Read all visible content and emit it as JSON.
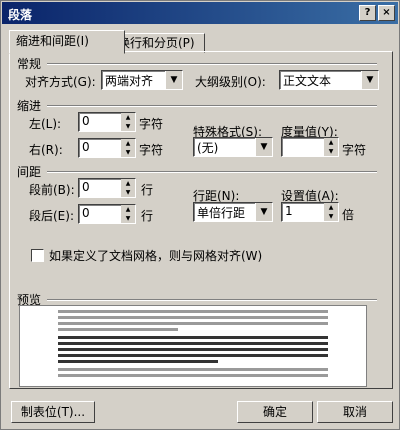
{
  "window": {
    "title": "段落",
    "help_label": "?",
    "close_label": "×"
  },
  "tabs": [
    {
      "label": "缩进和间距(I)"
    },
    {
      "label": "换行和分页(P)"
    }
  ],
  "general": {
    "section_label": "常规",
    "alignment_label": "对齐方式(G):",
    "alignment_value": "两端对齐",
    "outline_label": "大纲级别(O):",
    "outline_value": "正文文本"
  },
  "indent": {
    "section_label": "缩进",
    "left_label": "左(L):",
    "left_value": "0",
    "left_unit": "字符",
    "right_label": "右(R):",
    "right_value": "0",
    "right_unit": "字符",
    "special_label": "特殊格式(S):",
    "special_value": "(无)",
    "measure_label": "度量值(Y):",
    "measure_value": "",
    "measure_unit": "字符"
  },
  "spacing": {
    "section_label": "间距",
    "before_label": "段前(B):",
    "before_value": "0",
    "before_unit": "行",
    "after_label": "段后(E):",
    "after_value": "0",
    "after_unit": "行",
    "line_label": "行距(N):",
    "line_value": "单倍行距",
    "setting_label": "设置值(A):",
    "setting_value": "1",
    "setting_unit": "倍"
  },
  "grid_checkbox": {
    "label": "如果定义了文档网格，则与网格对齐(W)",
    "checked": false
  },
  "preview": {
    "section_label": "预览"
  },
  "buttons": {
    "tabs_label": "制表位(T)...",
    "ok_label": "确定",
    "cancel_label": "取消"
  },
  "icons": {
    "spin_up": "up-arrow-icon",
    "spin_down": "down-arrow-icon",
    "dropdown": "chevron-down-icon"
  },
  "colors": {
    "titlebar": "#0a246a",
    "dialog_bg": "#d4d0c8"
  }
}
